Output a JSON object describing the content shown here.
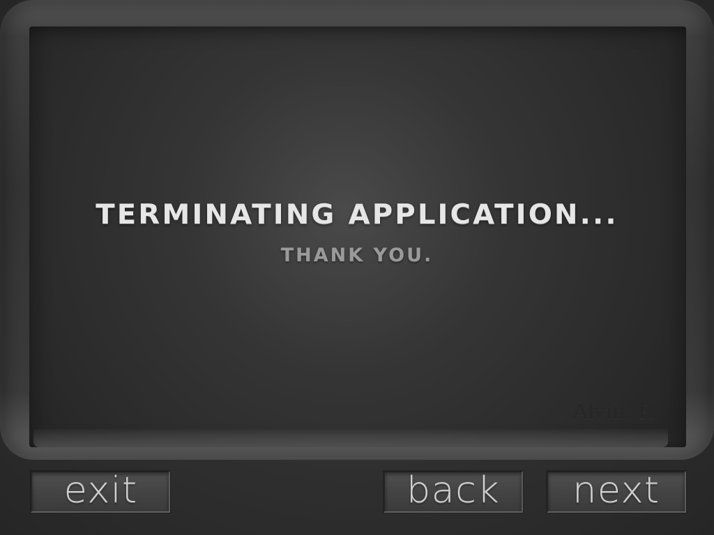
{
  "screen": {
    "title": "TERMINATING APPLICATION...",
    "subtitle": "THANK YOU.",
    "signature": "Alvin. R."
  },
  "buttons": {
    "exit": "exit",
    "back": "back",
    "next": "next"
  },
  "colors": {
    "background": "#2a2a2a",
    "screen": "#353535",
    "title_text": "#e6e6e6",
    "subtitle_text": "#9a9a9a",
    "button_text": "#cfcfcf"
  }
}
